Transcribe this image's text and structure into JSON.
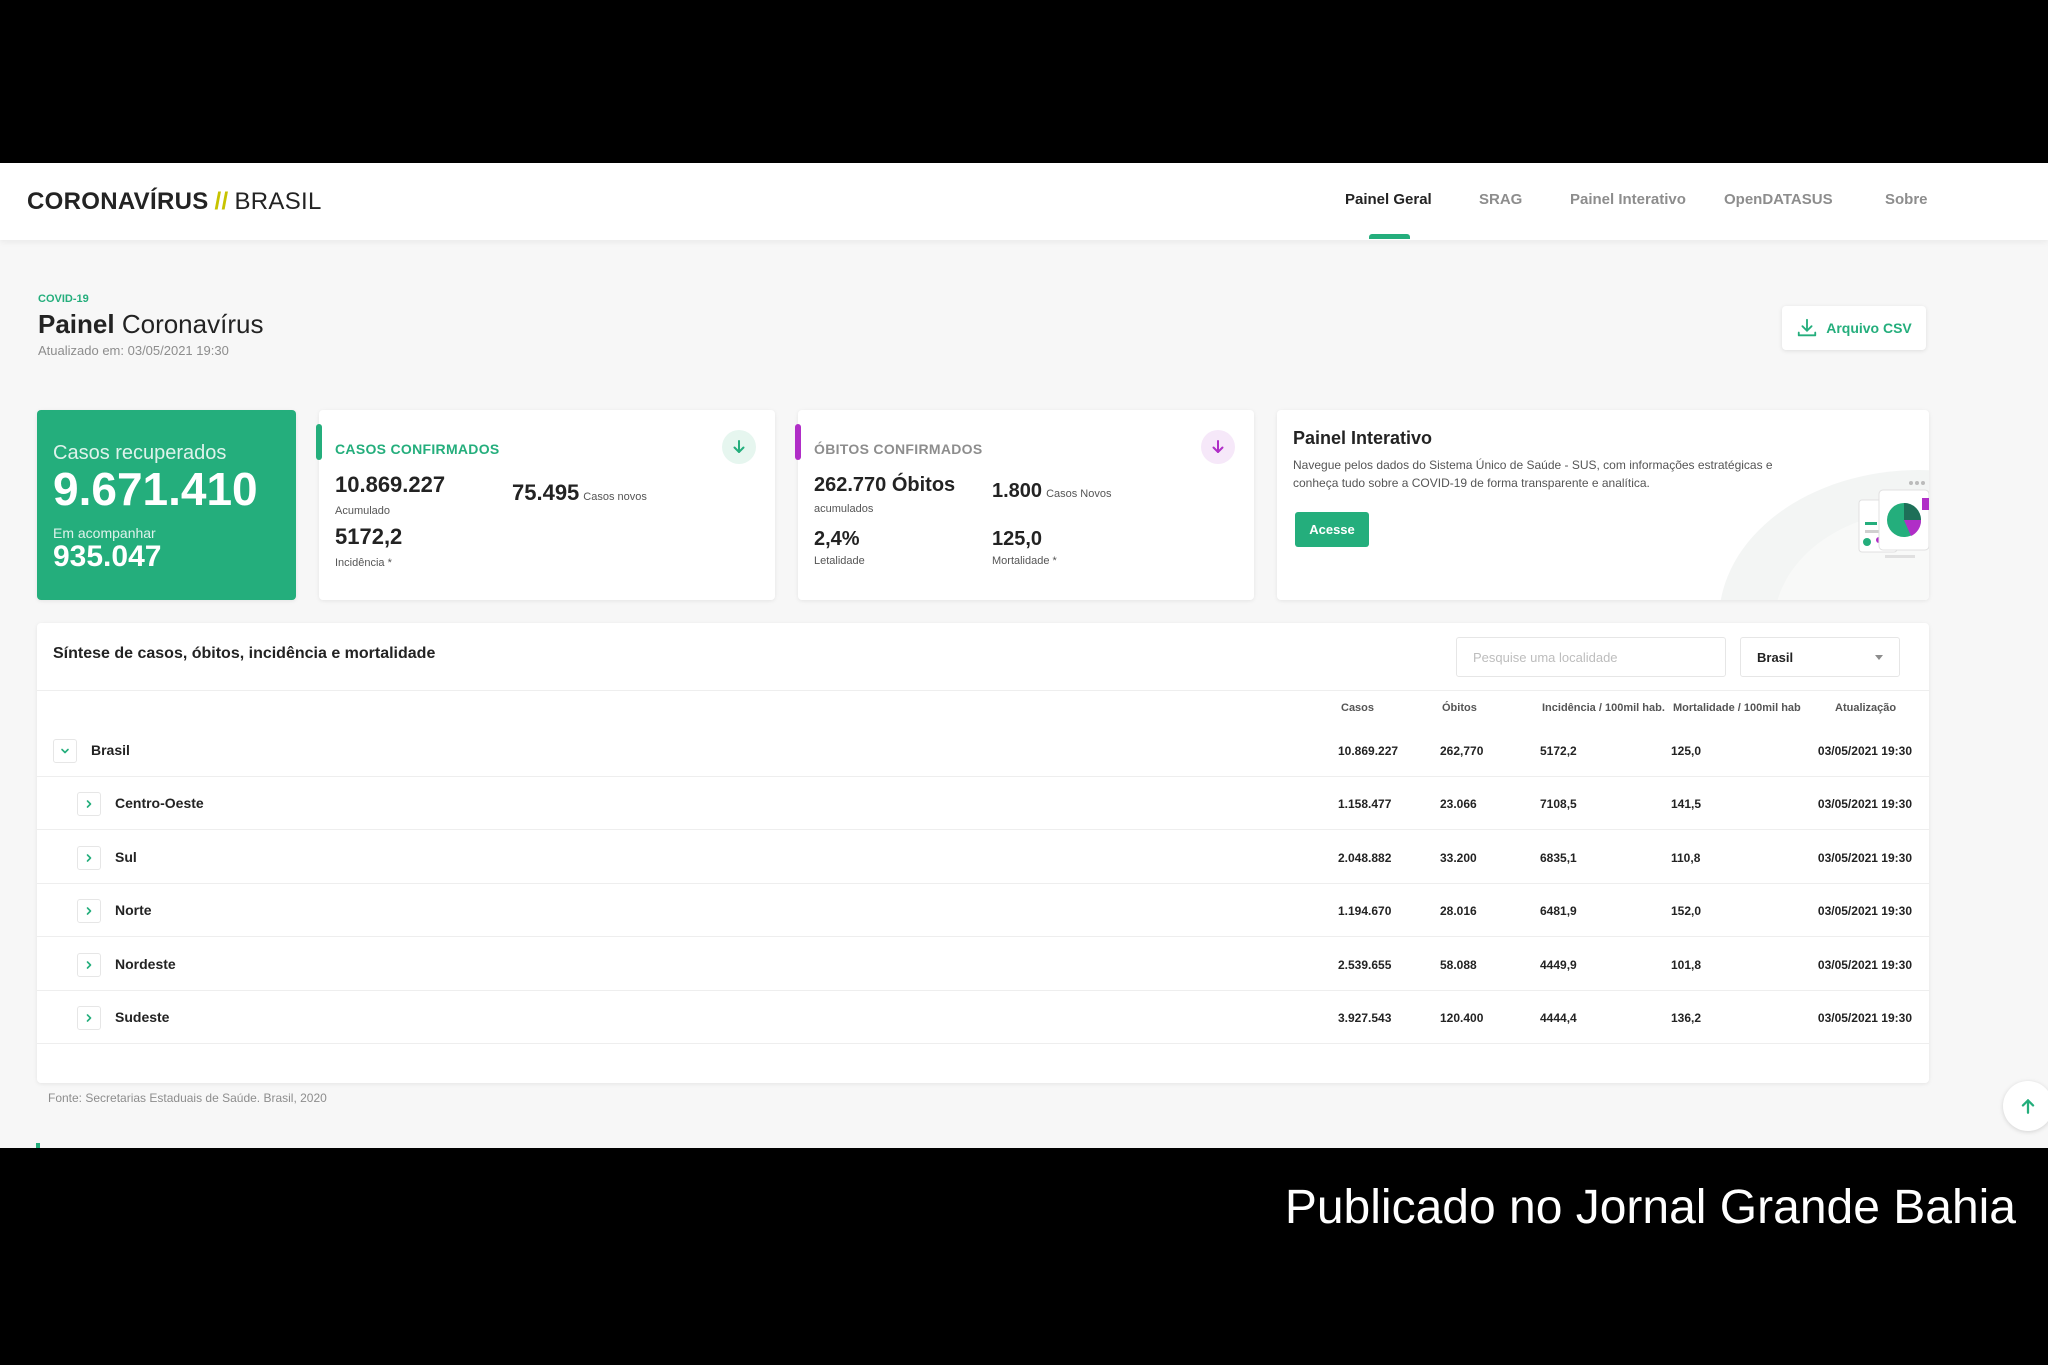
{
  "header": {
    "brand_primary": "CORONAVÍRUS",
    "brand_slash": "//",
    "brand_secondary": "BRASIL",
    "nav": [
      {
        "label": "Painel Geral",
        "active": true
      },
      {
        "label": "SRAG",
        "active": false
      },
      {
        "label": "Painel Interativo",
        "active": false
      },
      {
        "label": "OpenDATASUS",
        "active": false
      },
      {
        "label": "Sobre",
        "active": false
      }
    ]
  },
  "page": {
    "tag": "COVID-19",
    "title_bold": "Painel",
    "title_rest": "Coronavírus",
    "updated": "Atualizado em: 03/05/2021 19:30",
    "csv_label": "Arquivo CSV"
  },
  "cards": {
    "recovered": {
      "label": "Casos recuperados",
      "value": "9.671.410",
      "sub_label": "Em acompanhar",
      "sub_value": "935.047"
    },
    "cases": {
      "title": "CASOS CONFIRMADOS",
      "accumulated": "10.869.227",
      "accumulated_label": "Acumulado",
      "new": "75.495",
      "new_label": "Casos novos",
      "incidence": "5172,2",
      "incidence_label": "Incidência *"
    },
    "deaths": {
      "title": "ÓBITOS CONFIRMADOS",
      "accumulated": "262.770 Óbitos",
      "accumulated_label": "acumulados",
      "new": "1.800",
      "new_label": "Casos Novos",
      "lethality": "2,4%",
      "lethality_label": "Letalidade",
      "mortality": "125,0",
      "mortality_label": "Mortalidade *"
    },
    "painel": {
      "title": "Painel Interativo",
      "description": "Navegue pelos dados do Sistema Único de Saúde - SUS, com informações estratégicas e conheça tudo sobre a COVID-19 de forma transparente e analítica.",
      "button": "Acesse"
    }
  },
  "table": {
    "title": "Síntese de casos, óbitos, incidência e mortalidade",
    "search_placeholder": "Pesquise uma localidade",
    "select_value": "Brasil",
    "columns": [
      "Casos",
      "Óbitos",
      "Incidência / 100mil hab.",
      "Mortalidade / 100mil hab",
      "Atualização"
    ],
    "rows": [
      {
        "name": "Brasil",
        "cases": "10.869.227",
        "deaths": "262,770",
        "incidence": "5172,2",
        "mortality": "125,0",
        "updated": "03/05/2021 19:30"
      },
      {
        "name": "Centro-Oeste",
        "cases": "1.158.477",
        "deaths": "23.066",
        "incidence": "7108,5",
        "mortality": "141,5",
        "updated": "03/05/2021 19:30"
      },
      {
        "name": "Sul",
        "cases": "2.048.882",
        "deaths": "33.200",
        "incidence": "6835,1",
        "mortality": "110,8",
        "updated": "03/05/2021 19:30"
      },
      {
        "name": "Norte",
        "cases": "1.194.670",
        "deaths": "28.016",
        "incidence": "6481,9",
        "mortality": "152,0",
        "updated": "03/05/2021 19:30"
      },
      {
        "name": "Nordeste",
        "cases": "2.539.655",
        "deaths": "58.088",
        "incidence": "4449,9",
        "mortality": "101,8",
        "updated": "03/05/2021 19:30"
      },
      {
        "name": "Sudeste",
        "cases": "3.927.543",
        "deaths": "120.400",
        "incidence": "4444,4",
        "mortality": "136,2",
        "updated": "03/05/2021 19:30"
      }
    ]
  },
  "footnote": "Fonte: Secretarias Estaduais de Saúde. Brasil, 2020",
  "watermark": "Publicado no Jornal Grande Bahia",
  "colors": {
    "accent_green": "#24ae7c",
    "accent_purple": "#b02ec7",
    "brand_slash": "#c7c300",
    "text_dark": "#232323",
    "text_muted": "#8d8d8d"
  },
  "icons": {
    "csv": "download-icon",
    "cases_arrow": "arrow-down-icon",
    "deaths_arrow": "arrow-down-icon",
    "row_expanded": "chevron-down-icon",
    "row_collapsed": "chevron-right-icon",
    "select_caret": "caret-down-icon",
    "scroll_top": "arrow-up-icon"
  }
}
